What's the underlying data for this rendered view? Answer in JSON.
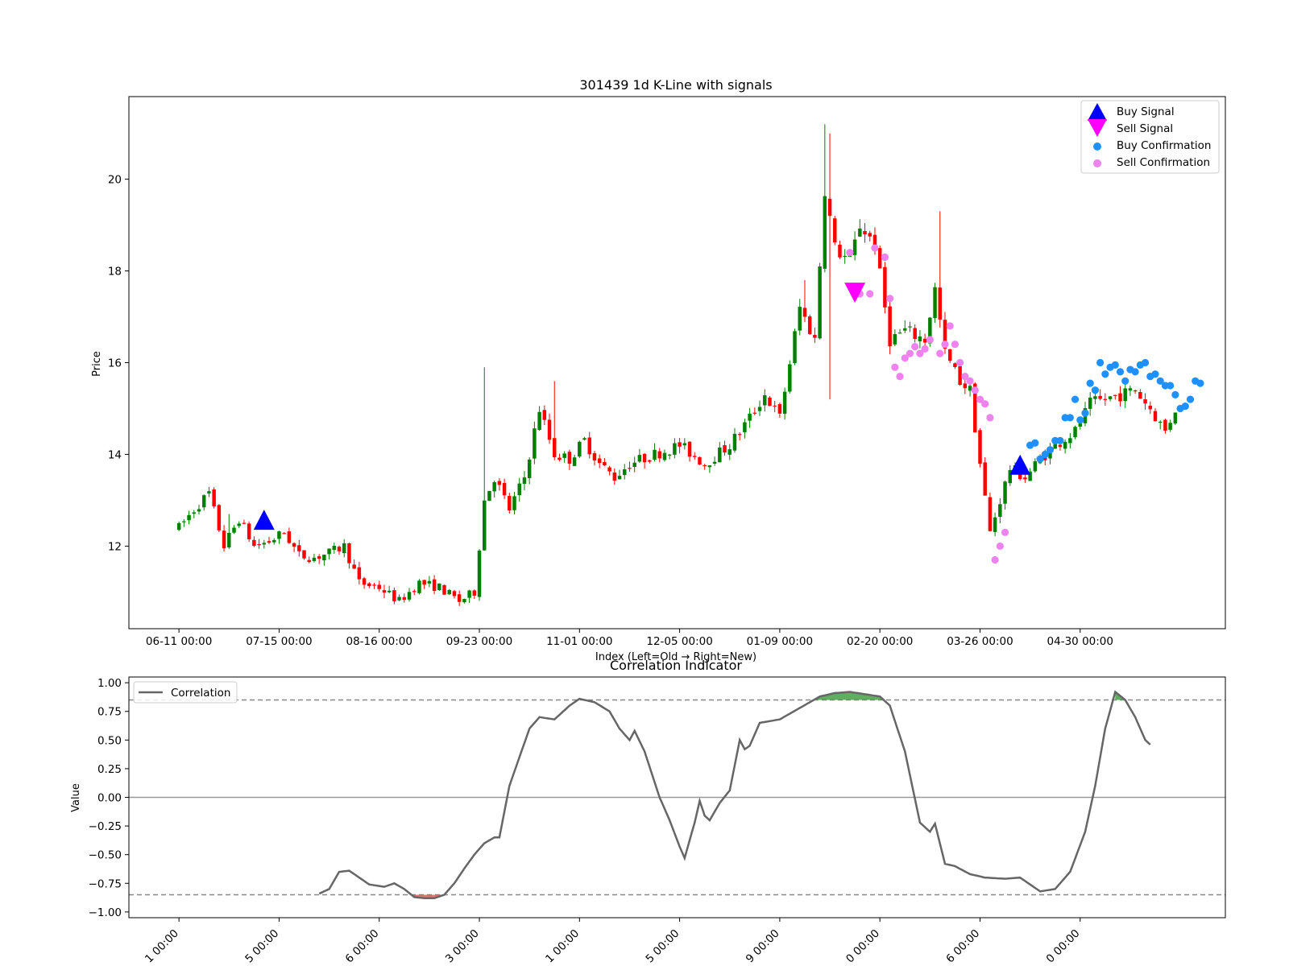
{
  "colors": {
    "up": "#008000",
    "down": "#ff0000",
    "buy_signal": "#0000ff",
    "sell_signal": "#ff00ff",
    "buy_confirm": "#1e90ff",
    "sell_confirm": "#ee82ee",
    "corr_line": "#666666",
    "fill_high": "#3a9a3a",
    "fill_low": "#d9534f"
  },
  "chart_data": [
    {
      "type": "candlestick",
      "title": "301439 1d K-Line with signals",
      "xlabel": "Index (Left=Old → Right=New)",
      "ylabel": "Price",
      "index_range": [
        -10,
        209
      ],
      "ylim": [
        10.2,
        21.8
      ],
      "yticks": [
        12,
        14,
        16,
        18,
        20
      ],
      "xticks": [
        {
          "index": 0,
          "label": "06-11 00:00"
        },
        {
          "index": 20,
          "label": "07-15 00:00"
        },
        {
          "index": 40,
          "label": "08-16 00:00"
        },
        {
          "index": 60,
          "label": "09-23 00:00"
        },
        {
          "index": 80,
          "label": "11-01 00:00"
        },
        {
          "index": 100,
          "label": "12-05 00:00"
        },
        {
          "index": 120,
          "label": "01-09 00:00"
        },
        {
          "index": 140,
          "label": "02-20 00:00"
        },
        {
          "index": 160,
          "label": "03-26 00:00"
        },
        {
          "index": 180,
          "label": "04-30 00:00"
        }
      ],
      "legend": {
        "position": "top-right",
        "entries": [
          {
            "label": "Buy Signal",
            "marker": "triangle-up"
          },
          {
            "label": "Sell Signal",
            "marker": "triangle-down"
          },
          {
            "label": "Buy Confirmation",
            "marker": "dot"
          },
          {
            "label": "Sell Confirmation",
            "marker": "dot"
          }
        ]
      },
      "anchors": [
        [
          0,
          12.4
        ],
        [
          3,
          12.8
        ],
        [
          6,
          13.15
        ],
        [
          9,
          12.0
        ],
        [
          12,
          12.6
        ],
        [
          15,
          12.0
        ],
        [
          18,
          12.1
        ],
        [
          21,
          12.3
        ],
        [
          24,
          11.8
        ],
        [
          27,
          11.75
        ],
        [
          30,
          11.85
        ],
        [
          33,
          12.0
        ],
        [
          36,
          11.2
        ],
        [
          40,
          11.1
        ],
        [
          44,
          10.8
        ],
        [
          48,
          11.2
        ],
        [
          52,
          11.1
        ],
        [
          56,
          10.8
        ],
        [
          59,
          11.0
        ],
        [
          61,
          13.0
        ],
        [
          63,
          13.5
        ],
        [
          66,
          12.8
        ],
        [
          69,
          13.5
        ],
        [
          72,
          15.0
        ],
        [
          75,
          14.0
        ],
        [
          78,
          13.9
        ],
        [
          81,
          14.3
        ],
        [
          84,
          13.8
        ],
        [
          87,
          13.5
        ],
        [
          90,
          13.8
        ],
        [
          95,
          14.0
        ],
        [
          100,
          14.2
        ],
        [
          105,
          13.8
        ],
        [
          110,
          14.2
        ],
        [
          114,
          14.8
        ],
        [
          117,
          15.3
        ],
        [
          120,
          14.8
        ],
        [
          124,
          17.2
        ],
        [
          127,
          16.5
        ],
        [
          129,
          19.8
        ],
        [
          131,
          18.5
        ],
        [
          134,
          18.2
        ],
        [
          136,
          19.0
        ],
        [
          139,
          18.6
        ],
        [
          142,
          16.5
        ],
        [
          145,
          16.7
        ],
        [
          149,
          16.5
        ],
        [
          151,
          17.6
        ],
        [
          153,
          16.2
        ],
        [
          156,
          15.6
        ],
        [
          158,
          15.4
        ],
        [
          160,
          13.8
        ],
        [
          162,
          12.3
        ],
        [
          164,
          13.0
        ],
        [
          166,
          13.7
        ],
        [
          169,
          13.5
        ],
        [
          172,
          13.9
        ],
        [
          175,
          14.2
        ],
        [
          179,
          14.5
        ],
        [
          182,
          15.1
        ],
        [
          185,
          15.2
        ],
        [
          188,
          15.3
        ],
        [
          191,
          15.4
        ],
        [
          194,
          15.0
        ],
        [
          197,
          14.5
        ],
        [
          199,
          15.0
        ]
      ],
      "spikes": [
        {
          "index": 10,
          "high": 12.7
        },
        {
          "index": 61,
          "high": 15.9
        },
        {
          "index": 75,
          "high": 15.6
        },
        {
          "index": 125,
          "high": 17.8
        },
        {
          "index": 129,
          "high": 21.2
        },
        {
          "index": 130,
          "high": 21.0,
          "low": 15.2
        },
        {
          "index": 152,
          "high": 19.3
        },
        {
          "index": 165,
          "high": 11.4
        }
      ],
      "signals": [
        {
          "type": "buy",
          "index": 17,
          "price": 12.55
        },
        {
          "type": "sell",
          "index": 135,
          "price": 17.55
        },
        {
          "type": "buy",
          "index": 168,
          "price": 13.75
        }
      ],
      "sell_confirmations": [
        [
          136,
          17.5
        ],
        [
          138,
          17.5
        ],
        [
          142,
          17.4
        ],
        [
          143,
          15.9
        ],
        [
          144,
          15.7
        ],
        [
          145,
          16.1
        ],
        [
          146,
          16.2
        ],
        [
          147,
          16.35
        ],
        [
          148,
          16.2
        ],
        [
          149,
          16.3
        ],
        [
          150,
          16.5
        ],
        [
          152,
          16.2
        ],
        [
          153,
          16.4
        ],
        [
          154,
          16.8
        ],
        [
          155,
          16.4
        ],
        [
          156,
          16.0
        ],
        [
          157,
          15.7
        ],
        [
          158,
          15.6
        ],
        [
          159,
          15.4
        ],
        [
          160,
          15.2
        ],
        [
          161,
          15.1
        ],
        [
          162,
          14.8
        ],
        [
          163,
          11.7
        ],
        [
          164,
          12.0
        ],
        [
          165,
          12.3
        ],
        [
          134,
          18.4
        ],
        [
          139,
          18.5
        ],
        [
          141,
          18.3
        ]
      ],
      "buy_confirmations": [
        [
          170,
          14.2
        ],
        [
          171,
          14.25
        ],
        [
          172,
          13.9
        ],
        [
          173,
          14.0
        ],
        [
          174,
          14.1
        ],
        [
          175,
          14.3
        ],
        [
          176,
          14.3
        ],
        [
          177,
          14.8
        ],
        [
          178,
          14.8
        ],
        [
          179,
          15.2
        ],
        [
          180,
          14.75
        ],
        [
          181,
          14.9
        ],
        [
          182,
          15.55
        ],
        [
          183,
          15.4
        ],
        [
          184,
          16.0
        ],
        [
          185,
          15.75
        ],
        [
          186,
          15.9
        ],
        [
          187,
          15.95
        ],
        [
          188,
          15.8
        ],
        [
          189,
          15.6
        ],
        [
          190,
          15.85
        ],
        [
          191,
          15.8
        ],
        [
          192,
          15.95
        ],
        [
          193,
          16.0
        ],
        [
          194,
          15.7
        ],
        [
          195,
          15.75
        ],
        [
          196,
          15.6
        ],
        [
          197,
          15.5
        ],
        [
          198,
          15.5
        ],
        [
          199,
          15.3
        ],
        [
          200,
          15.0
        ],
        [
          201,
          15.05
        ],
        [
          202,
          15.2
        ],
        [
          203,
          15.6
        ],
        [
          204,
          15.55
        ]
      ]
    },
    {
      "type": "line",
      "title": "Correlation Indicator",
      "ylabel": "Value",
      "ylim": [
        -1.05,
        1.05
      ],
      "yticks": [
        1.0,
        0.75,
        0.5,
        0.25,
        0.0,
        -0.25,
        -0.5,
        -0.75,
        -1.0
      ],
      "ytick_labels": [
        "1.00",
        "0.75",
        "0.50",
        "0.25",
        "0.00",
        "−0.25",
        "−0.50",
        "−0.75",
        "−1.00"
      ],
      "thresholds": [
        0.85,
        -0.85
      ],
      "zero_line": 0,
      "legend": {
        "position": "top-left",
        "entries": [
          "Correlation"
        ]
      },
      "xtick_labels": [
        "1 00:00",
        "5 00:00",
        "6 00:00",
        "3 00:00",
        "1 00:00",
        "5 00:00",
        "9 00:00",
        "0 00:00",
        "6 00:00",
        "0 00:00"
      ],
      "series": [
        {
          "name": "Correlation",
          "points": [
            [
              28,
              -0.84
            ],
            [
              30,
              -0.8
            ],
            [
              32,
              -0.65
            ],
            [
              34,
              -0.64
            ],
            [
              36,
              -0.7
            ],
            [
              38,
              -0.76
            ],
            [
              41,
              -0.78
            ],
            [
              43,
              -0.75
            ],
            [
              45,
              -0.8
            ],
            [
              47,
              -0.87
            ],
            [
              49,
              -0.88
            ],
            [
              51,
              -0.88
            ],
            [
              53,
              -0.85
            ],
            [
              55,
              -0.75
            ],
            [
              57,
              -0.62
            ],
            [
              59,
              -0.5
            ],
            [
              61,
              -0.4
            ],
            [
              63,
              -0.35
            ],
            [
              64,
              -0.35
            ],
            [
              66,
              0.1
            ],
            [
              68,
              0.35
            ],
            [
              70,
              0.6
            ],
            [
              72,
              0.7
            ],
            [
              75,
              0.68
            ],
            [
              78,
              0.8
            ],
            [
              80,
              0.86
            ],
            [
              83,
              0.83
            ],
            [
              86,
              0.75
            ],
            [
              88,
              0.6
            ],
            [
              90,
              0.5
            ],
            [
              91,
              0.58
            ],
            [
              93,
              0.4
            ],
            [
              96,
              0.0
            ],
            [
              98,
              -0.2
            ],
            [
              100,
              -0.43
            ],
            [
              101,
              -0.53
            ],
            [
              103,
              -0.22
            ],
            [
              104,
              -0.03
            ],
            [
              105,
              -0.16
            ],
            [
              106,
              -0.2
            ],
            [
              108,
              -0.05
            ],
            [
              110,
              0.06
            ],
            [
              112,
              0.5
            ],
            [
              113,
              0.42
            ],
            [
              114,
              0.45
            ],
            [
              116,
              0.65
            ],
            [
              120,
              0.68
            ],
            [
              124,
              0.78
            ],
            [
              128,
              0.88
            ],
            [
              131,
              0.91
            ],
            [
              134,
              0.92
            ],
            [
              137,
              0.9
            ],
            [
              140,
              0.88
            ],
            [
              142,
              0.8
            ],
            [
              145,
              0.4
            ],
            [
              148,
              -0.22
            ],
            [
              150,
              -0.3
            ],
            [
              151,
              -0.23
            ],
            [
              153,
              -0.58
            ],
            [
              155,
              -0.6
            ],
            [
              158,
              -0.67
            ],
            [
              161,
              -0.7
            ],
            [
              165,
              -0.71
            ],
            [
              168,
              -0.7
            ],
            [
              172,
              -0.82
            ],
            [
              175,
              -0.8
            ],
            [
              178,
              -0.65
            ],
            [
              181,
              -0.3
            ],
            [
              183,
              0.1
            ],
            [
              185,
              0.6
            ],
            [
              187,
              0.92
            ],
            [
              189,
              0.85
            ],
            [
              191,
              0.7
            ],
            [
              193,
              0.5
            ],
            [
              194,
              0.46
            ]
          ]
        }
      ]
    }
  ]
}
